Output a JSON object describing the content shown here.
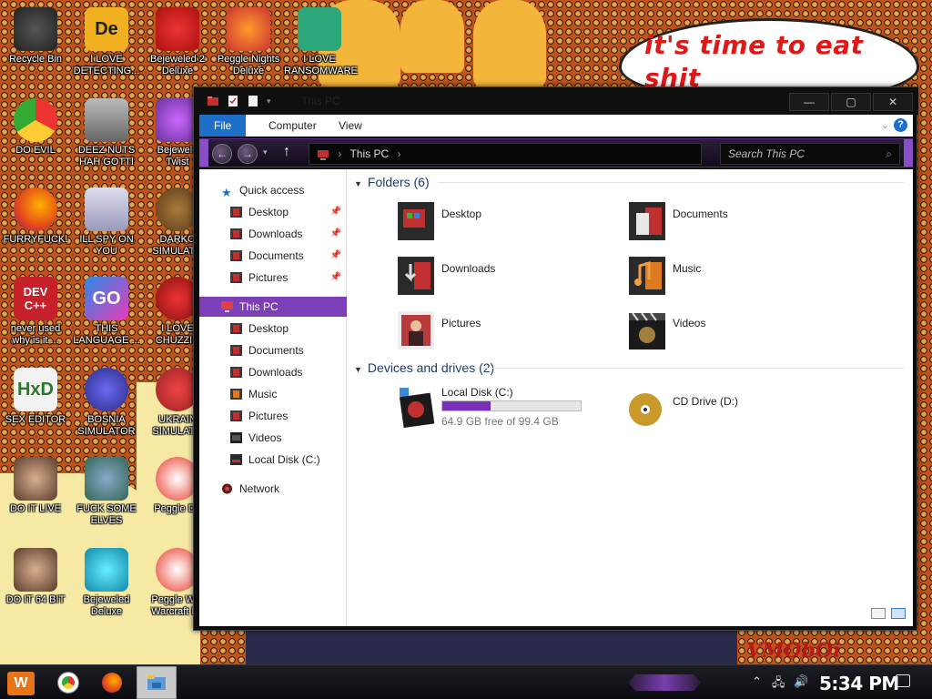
{
  "desktop": {
    "icons": [
      {
        "label": "Recycle Bin"
      },
      {
        "label": "I LOVE\nDETECTING..."
      },
      {
        "label": "Bejeweled 2\nDeluxe"
      },
      {
        "label": "Peggle Nights\nDeluxe"
      },
      {
        "label": "I LOVE\nRANSOMWARE"
      },
      {
        "label": "DO EVIL"
      },
      {
        "label": "DEEZ NUTS\nHAH GOTTI"
      },
      {
        "label": "Bejewele\nTwist"
      },
      {
        "label": "FURRYFUCK!"
      },
      {
        "label": "ILL SPY ON\nYOU"
      },
      {
        "label": "DARKO\nSIMULATO"
      },
      {
        "label": "never used\nwhy is it ..."
      },
      {
        "label": "THIS\nLANGUAGE ..."
      },
      {
        "label": "I LOVE\nCHUZZIN"
      },
      {
        "label": "SEX EDITOR"
      },
      {
        "label": "BOSNIA\nSIMULATOR"
      },
      {
        "label": "UKRAIN\nSIMULATO"
      },
      {
        "label": "DO IT LIVE"
      },
      {
        "label": "FUCK SOME\nELVES"
      },
      {
        "label": "Peggle De"
      },
      {
        "label": "DO IT 64 BIT"
      },
      {
        "label": "Bejeweled\nDeluxe"
      },
      {
        "label": "Peggle Wor\nWarcraft Ed"
      }
    ],
    "icon_glyphs": {
      "dev_text": "DEV\nC++",
      "go_text": "GO",
      "de_text": "De",
      "hxd_text": "HxD"
    },
    "wallpaper_text": "it's time to eat shit\nand die and chew",
    "watermark": "VMObOi"
  },
  "window": {
    "title": "This PC",
    "buttons": {
      "minimize": "—",
      "maximize": "▢",
      "close": "✕"
    },
    "ribbon": {
      "tabs": [
        "File",
        "Computer",
        "View"
      ],
      "help": "?",
      "chevron": "⌄"
    },
    "nav": {
      "back": "←",
      "forward": "→",
      "dropdown": "▾",
      "up": "↑"
    },
    "address": {
      "crumb": "This PC",
      "sep": "›"
    },
    "search": {
      "placeholder": "Search This PC",
      "icon": "⌕"
    },
    "sidebar": {
      "quick_access": "Quick access",
      "quick_items": [
        "Desktop",
        "Downloads",
        "Documents",
        "Pictures"
      ],
      "pin": "📌",
      "this_pc": "This PC",
      "pc_items": [
        "Desktop",
        "Documents",
        "Downloads",
        "Music",
        "Pictures",
        "Videos",
        "Local Disk (C:)"
      ],
      "network": "Network"
    },
    "folders_header": "Folders (6)",
    "folders": [
      "Desktop",
      "Documents",
      "Downloads",
      "Music",
      "Pictures",
      "Videos"
    ],
    "devices_header": "Devices and drives (2)",
    "drives": [
      {
        "name": "Local Disk (C:)",
        "free_text": "64.9 GB free of 99.4 GB",
        "used_fraction": 0.347
      },
      {
        "name": "CD Drive (D:)"
      }
    ]
  },
  "taskbar": {
    "start_glyph": "W",
    "clock": "5:34 PM",
    "tray": {
      "chevron": "⌃",
      "network": "🖧",
      "volume": "🔊"
    }
  },
  "colors": {
    "accent_purple": "#7d3fb8",
    "file_tab_blue": "#1e6fc8",
    "wallpaper_red": "#c2521a"
  }
}
